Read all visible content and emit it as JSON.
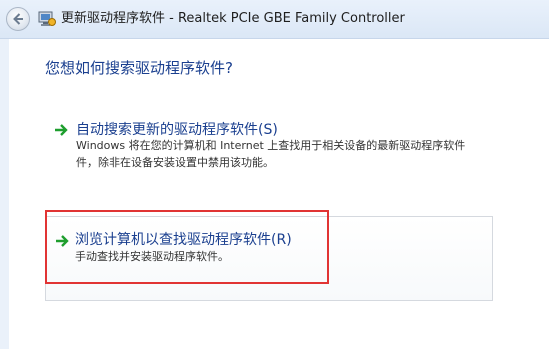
{
  "window": {
    "title": "更新驱动程序软件 - Realtek PCIe GBE Family Controller"
  },
  "main": {
    "question": "您想如何搜索驱动程序软件?",
    "options": [
      {
        "title": "自动搜索更新的驱动程序软件(S)",
        "desc_lines": [
          "Windows 将在您的计算机和 Internet 上查找用于相关设备的最新驱动程序软件",
          "件，除非在设备安装设置中禁用该功能。"
        ]
      },
      {
        "title": "浏览计算机以查找驱动程序软件(R)",
        "desc": "手动查找并安装驱动程序软件。"
      }
    ]
  },
  "colors": {
    "link_blue": "#1a3f8f",
    "arrow_green": "#1e9e2e",
    "highlight_red": "#e13434"
  },
  "icons": {
    "back": "back-arrow-icon",
    "device": "device-manager-icon",
    "option": "green-arrow-icon"
  }
}
